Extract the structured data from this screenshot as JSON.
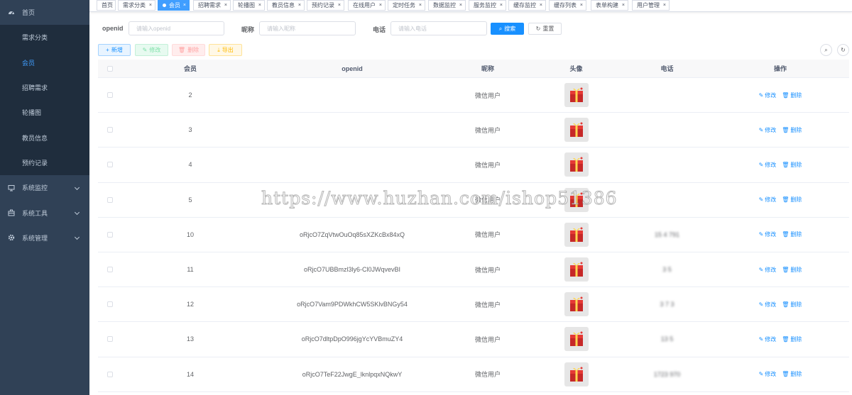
{
  "sidebar": {
    "items": [
      {
        "label": "首页",
        "icon": "dashboard-icon"
      },
      {
        "label": "需求分类",
        "icon": ""
      },
      {
        "label": "会员",
        "icon": ""
      },
      {
        "label": "招聘需求",
        "icon": ""
      },
      {
        "label": "轮播图",
        "icon": ""
      },
      {
        "label": "教员信息",
        "icon": ""
      },
      {
        "label": "预约记录",
        "icon": ""
      },
      {
        "label": "系统监控",
        "icon": "monitor-icon"
      },
      {
        "label": "系统工具",
        "icon": "tool-icon"
      },
      {
        "label": "系统管理",
        "icon": "gear-icon"
      }
    ],
    "active": "会员"
  },
  "tags": [
    "首页",
    "需求分类",
    "会员",
    "招聘需求",
    "轮播图",
    "教员信息",
    "预约记录",
    "在线用户",
    "定时任务",
    "数据监控",
    "服务监控",
    "缓存监控",
    "缓存列表",
    "表单构建",
    "用户管理"
  ],
  "search": {
    "openid_label": "openid",
    "openid_placeholder": "请输入openid",
    "nickname_label": "昵称",
    "nickname_placeholder": "请输入昵称",
    "phone_label": "电话",
    "phone_placeholder": "请输入电话",
    "search_btn": "搜索",
    "reset_btn": "重置"
  },
  "toolbar": {
    "add": "新增",
    "edit": "修改",
    "delete": "删除",
    "export": "导出"
  },
  "table": {
    "headers": {
      "id": "会员",
      "openid": "openid",
      "nickname": "昵称",
      "avatar": "头像",
      "phone": "电话",
      "ops": "操作"
    },
    "edit_label": "修改",
    "delete_label": "删除",
    "rows": [
      {
        "id": "2",
        "openid": "",
        "nickname": "微信用户",
        "phone": ""
      },
      {
        "id": "3",
        "openid": "",
        "nickname": "微信用户",
        "phone": ""
      },
      {
        "id": "4",
        "openid": "",
        "nickname": "微信用户",
        "phone": ""
      },
      {
        "id": "5",
        "openid": "",
        "nickname": "微信用户",
        "phone": ""
      },
      {
        "id": "10",
        "openid": "oRjcO7ZqVtwOuOq85sXZKcBx84xQ",
        "nickname": "微信用户",
        "phone": "15 4 791"
      },
      {
        "id": "11",
        "openid": "oRjcO7UBBmzl3ly6-Cl0JWqvevBI",
        "nickname": "微信用户",
        "phone": "3 5"
      },
      {
        "id": "12",
        "openid": "oRjcO7Vam9PDWkhCW5SKlvBNGy54",
        "nickname": "微信用户",
        "phone": "3 7 3"
      },
      {
        "id": "13",
        "openid": "oRjcO7dltpDpO996jgYcYVBmuZY4",
        "nickname": "微信用户",
        "phone": "13 5"
      },
      {
        "id": "14",
        "openid": "oRjcO7TeF22JwgE_lknlpqxNQkwY",
        "nickname": "微信用户",
        "phone": "1723 970"
      }
    ]
  },
  "watermark": "https://www.huzhan.com/ishop51386",
  "colors": {
    "sidebar_bg": "#304156",
    "accent": "#1890ff",
    "active_tag": "#409eff"
  }
}
